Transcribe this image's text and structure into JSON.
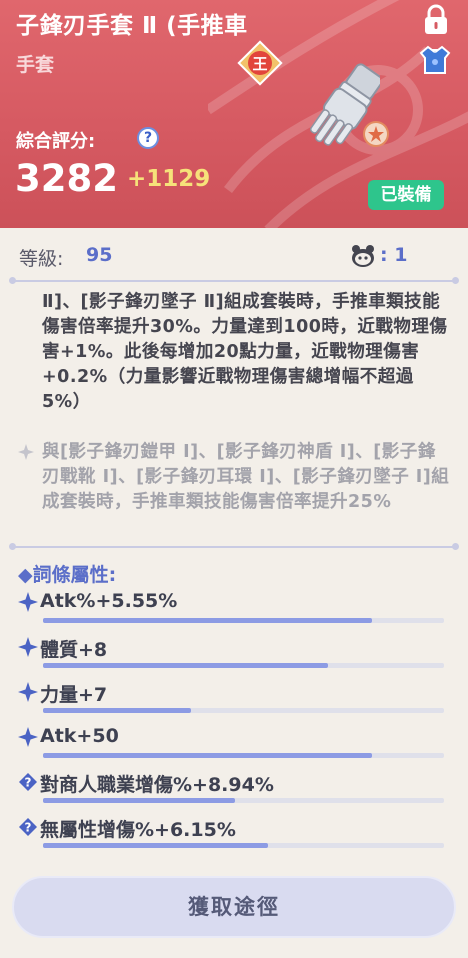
{
  "header": {
    "title": "子鋒刃手套 Ⅱ (手推車",
    "subtitle": "手套",
    "rank_badge": "王",
    "score_label": "綜合評分:",
    "score": "3282",
    "score_bonus": "+1129",
    "equipped_label": "已裝備"
  },
  "level": {
    "label": "等級:",
    "value": "95",
    "pet_count": ": 1"
  },
  "set_effects": {
    "active_text": "Ⅱ]、[影子鋒刃墜子 Ⅱ]組成套裝時，手推車類技能傷害倍率提升30%。力量達到100時，近戰物理傷害+1%。此後每增加20點力量，近戰物理傷害+0.2%（力量影響近戰物理傷害總增幅不超過5%）",
    "inactive_text": "與[影子鋒刃鎧甲 Ⅰ]、[影子鋒刃神盾 Ⅰ]、[影子鋒刃戰靴 Ⅰ]、[影子鋒刃耳環 Ⅰ]、[影子鋒刃墜子 Ⅰ]組成套裝時，手推車類技能傷害倍率提升25%"
  },
  "affixes": {
    "header": "◆詞條屬性:",
    "items": [
      {
        "label": "Atk%+5.55%",
        "fill": 0.82,
        "icon": "sparkle-icon"
      },
      {
        "label": "體質+8",
        "fill": 0.71,
        "icon": "sparkle-icon"
      },
      {
        "label": "力量+7",
        "fill": 0.37,
        "icon": "sparkle-icon"
      },
      {
        "label": "Atk+50",
        "fill": 0.82,
        "icon": "sparkle-icon"
      },
      {
        "label": "對商人職業增傷%+8.94%",
        "fill": 0.48,
        "icon": "question-icon"
      },
      {
        "label": "無屬性增傷%+6.15%",
        "fill": 0.56,
        "icon": "question-icon"
      }
    ]
  },
  "footer": {
    "acquire_label": "獲取途徑"
  },
  "colors": {
    "header_bg": "#d65a62",
    "accent_blue": "#5b6ec9",
    "equipped_green": "#2ec58c",
    "bonus_yellow": "#f6e27a"
  }
}
